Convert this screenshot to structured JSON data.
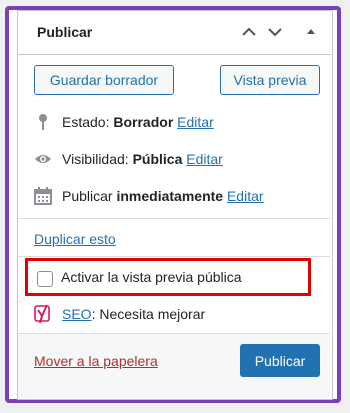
{
  "panel": {
    "title": "Publicar",
    "save_draft_label": "Guardar borrador",
    "preview_label": "Vista previa",
    "status": {
      "label": "Estado:",
      "value": "Borrador",
      "edit": "Editar"
    },
    "visibility": {
      "label": "Visibilidad:",
      "value": "Pública",
      "edit": "Editar"
    },
    "schedule": {
      "label": "Publicar",
      "value": "inmediatamente",
      "edit": "Editar"
    },
    "duplicate_label": "Duplicar esto",
    "public_preview_label": "Activar la vista previa pública",
    "seo": {
      "link": "SEO",
      "rest": ": Necesita mejorar"
    },
    "trash_label": "Mover a la papelera",
    "publish_label": "Publicar"
  },
  "colors": {
    "accent": "#2271b1",
    "frame": "#7b3fb8",
    "highlight": "#e00000",
    "trash": "#b32d2e",
    "seo_icon": "#d91c5c"
  }
}
